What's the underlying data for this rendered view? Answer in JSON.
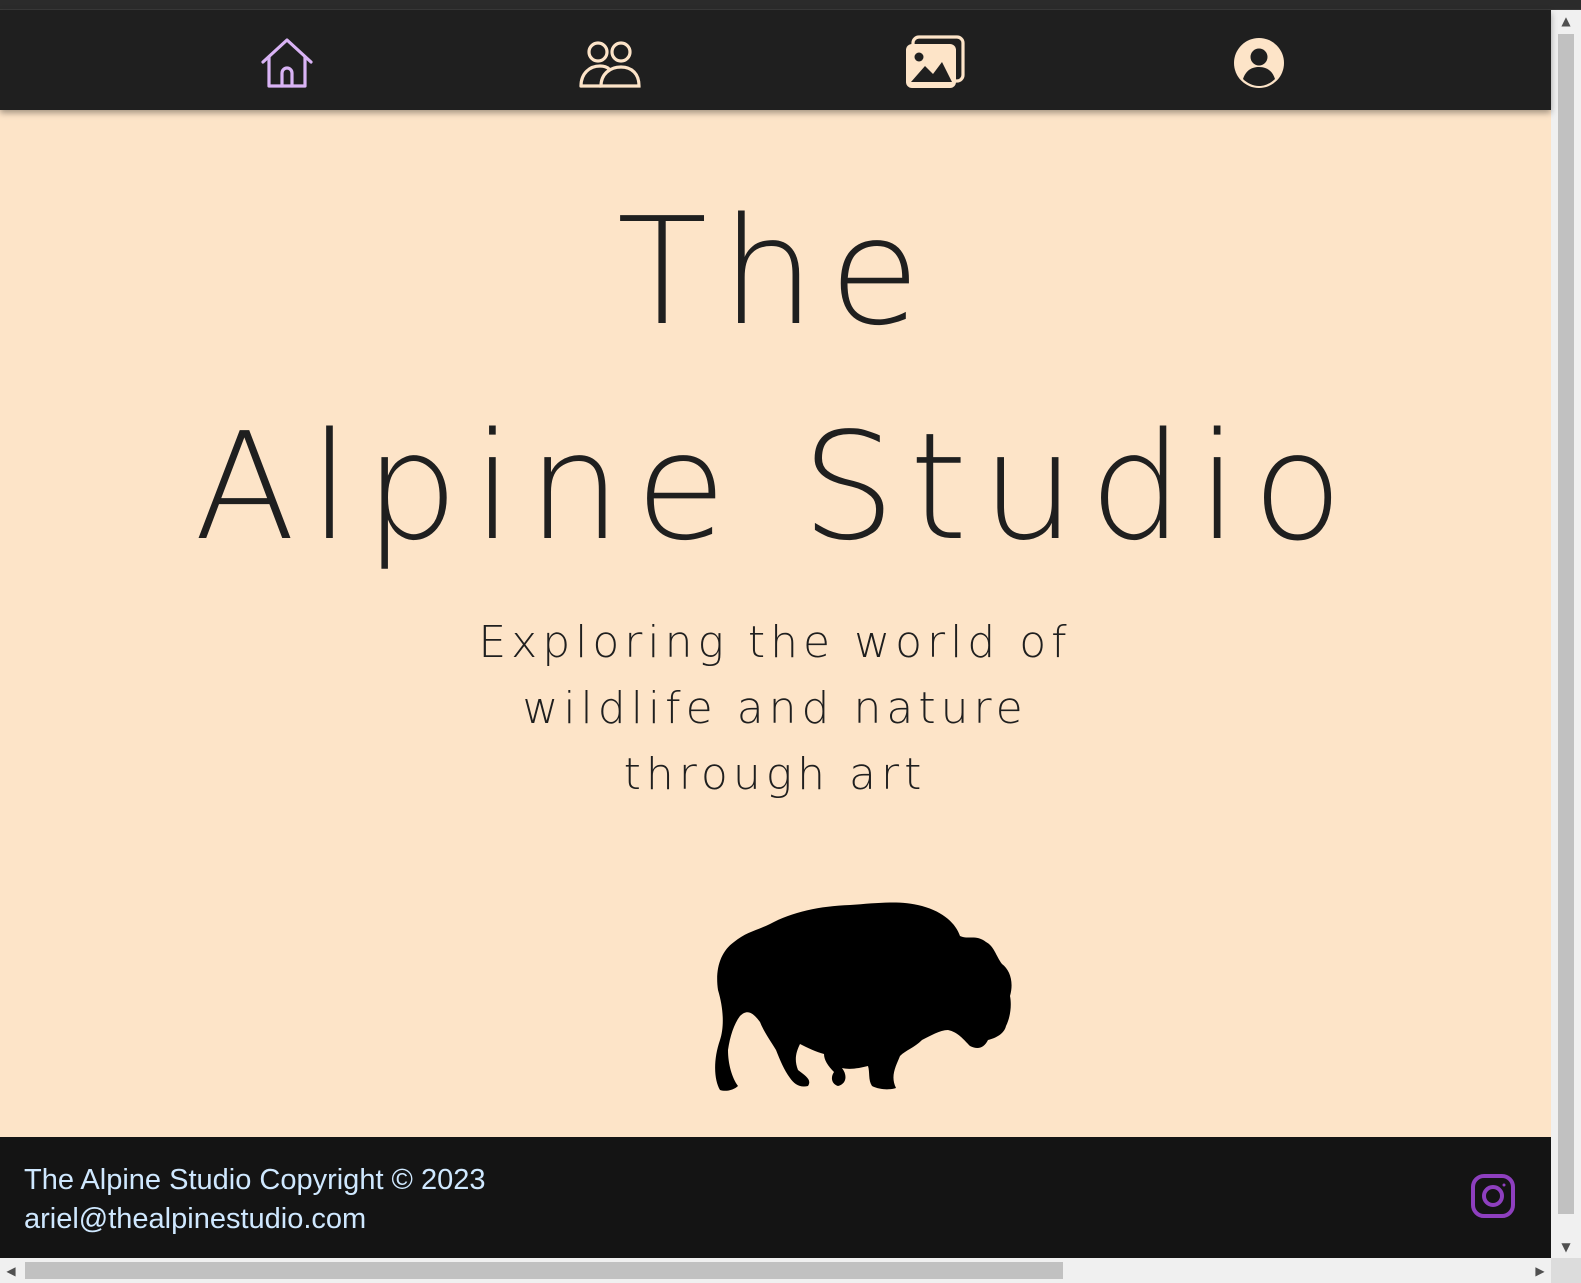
{
  "nav": {
    "items": [
      {
        "icon": "home-icon",
        "color": "#d9b3f5"
      },
      {
        "icon": "people-icon",
        "color": "#fde4c8"
      },
      {
        "icon": "gallery-icon",
        "color": "#fde4c8"
      },
      {
        "icon": "profile-icon",
        "color": "#fde4c8"
      }
    ]
  },
  "hero": {
    "title_line1": "The",
    "title_line2": "Alpine Studio",
    "subtitle_line1": "Exploring the world of",
    "subtitle_line2": "wildlife and nature",
    "subtitle_line3": "through art",
    "background": "#fde4c8",
    "illustration": "bison-silhouette"
  },
  "footer": {
    "copyright": "The Alpine Studio Copyright © 2023",
    "email": "ariel@thealpinestudio.com",
    "social_icon": "instagram-icon",
    "social_color": "#8e3fbf"
  },
  "scrollbars": {
    "vertical_arrow_up": "▲",
    "vertical_arrow_down": "▼",
    "horizontal_arrow_left": "◀",
    "horizontal_arrow_right": "▶"
  }
}
